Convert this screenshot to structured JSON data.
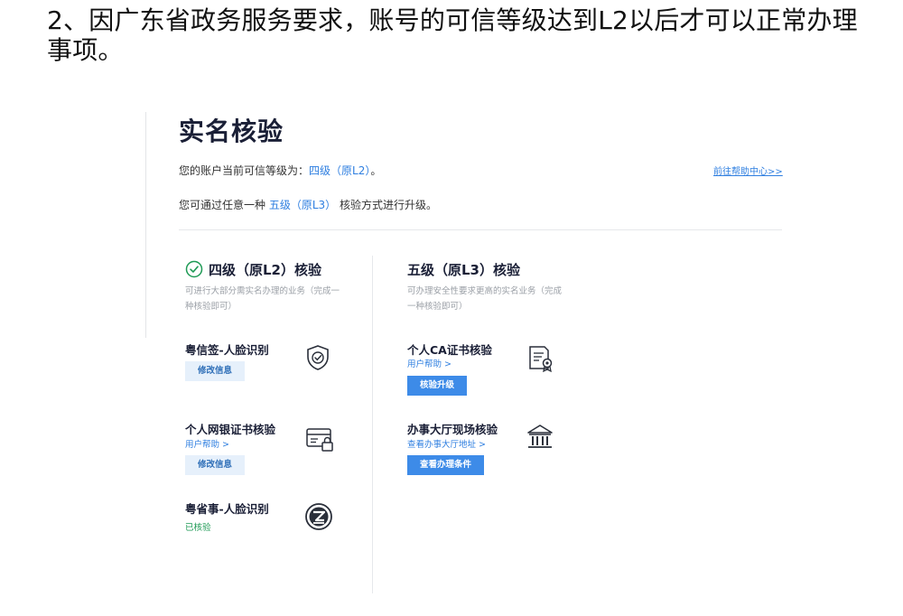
{
  "slide": {
    "title": "2、因广东省政务服务要求，账号的可信等级达到L2以后才可以正常办理事项。"
  },
  "page": {
    "title": "实名核验",
    "current_level_prefix": "您的账户当前可信等级为：",
    "current_level_value": "四级（原L2）",
    "current_level_suffix": "。",
    "upgrade_prefix": "您可通过任意一种",
    "upgrade_value": "五级（原L3）",
    "upgrade_suffix": "核验方式进行升级。",
    "help_link": "前往帮助中心>>"
  },
  "level4": {
    "heading": "四级（原L2）核验",
    "desc": "可进行大部分需实名办理的业务（完成一种核验即可）",
    "items": [
      {
        "title": "粤信签-人脸识别",
        "button": "修改信息",
        "icon": "shield-check-icon"
      },
      {
        "title": "个人网银证书核验",
        "link": "用户帮助 >",
        "button": "修改信息",
        "icon": "card-lock-icon"
      },
      {
        "title": "粤省事-人脸识别",
        "status": "已核验",
        "icon": "yueshengshi-logo-icon"
      }
    ]
  },
  "level5": {
    "heading": "五级（原L3）核验",
    "desc": "可办理安全性要求更高的实名业务（完成一种核验即可）",
    "items": [
      {
        "title": "个人CA证书核验",
        "link": "用户帮助 >",
        "button": "核验升级",
        "icon": "certificate-icon"
      },
      {
        "title": "办事大厅现场核验",
        "link": "查看办事大厅地址 >",
        "button": "查看办理条件",
        "icon": "hall-building-icon"
      }
    ]
  },
  "colors": {
    "accent": "#3d8be8",
    "link": "#2f7fe0",
    "success": "#1e9a55",
    "check": "#1e9a55"
  }
}
